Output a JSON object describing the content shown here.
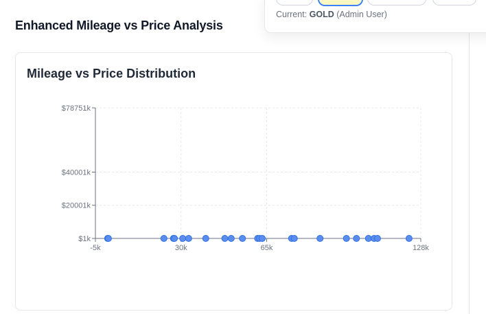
{
  "header": {
    "title": "Enhanced Mileage vs Price Analysis",
    "current_prefix": "Current:",
    "current_tier": "GOLD",
    "current_role": "(Admin User)"
  },
  "card": {
    "title": "Mileage vs Price Distribution"
  },
  "colors": {
    "point_fill": "#5b8def",
    "point_stroke": "#2f6fe0",
    "axis": "#6b7280",
    "grid": "#e5e7eb"
  },
  "chart_data": {
    "type": "scatter",
    "title": "Mileage vs Price Distribution",
    "xlabel": "",
    "ylabel": "",
    "xlim": [
      -5,
      128
    ],
    "ylim": [
      1,
      78751
    ],
    "x_ticks": [
      -5,
      30,
      65,
      128
    ],
    "x_tick_labels": [
      "-5k",
      "30k",
      "65k",
      "128k"
    ],
    "y_ticks": [
      1,
      20001,
      40001,
      78751
    ],
    "y_tick_labels": [
      "$1k",
      "$20001k",
      "$40001k",
      "$78751k"
    ],
    "grid": true,
    "points": [
      {
        "x": 0,
        "y": 1
      },
      {
        "x": 0.3,
        "y": 1
      },
      {
        "x": 23,
        "y": 1
      },
      {
        "x": 26.9,
        "y": 1
      },
      {
        "x": 27.3,
        "y": 1
      },
      {
        "x": 30.7,
        "y": 1
      },
      {
        "x": 33.1,
        "y": 1
      },
      {
        "x": 40.1,
        "y": 1
      },
      {
        "x": 47.9,
        "y": 1
      },
      {
        "x": 50.5,
        "y": 1
      },
      {
        "x": 55.1,
        "y": 1
      },
      {
        "x": 61.3,
        "y": 1
      },
      {
        "x": 62.1,
        "y": 1
      },
      {
        "x": 63.2,
        "y": 1
      },
      {
        "x": 75.2,
        "y": 1
      },
      {
        "x": 76.3,
        "y": 1
      },
      {
        "x": 86.8,
        "y": 1
      },
      {
        "x": 97.6,
        "y": 1
      },
      {
        "x": 101.7,
        "y": 1
      },
      {
        "x": 106.6,
        "y": 1
      },
      {
        "x": 108.9,
        "y": 1
      },
      {
        "x": 110.3,
        "y": 1
      },
      {
        "x": 123.2,
        "y": 1
      }
    ]
  }
}
